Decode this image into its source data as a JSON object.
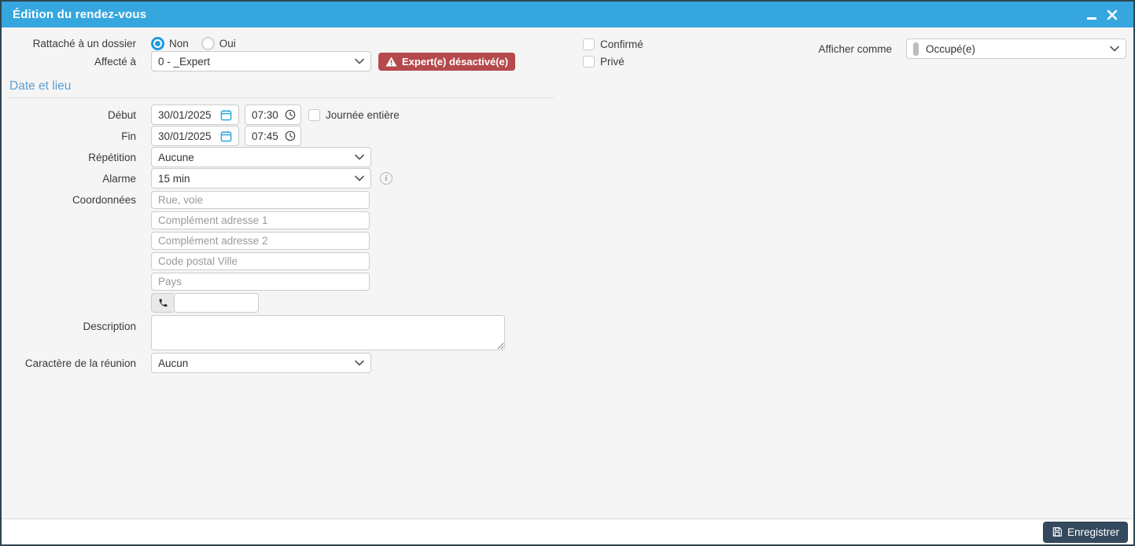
{
  "window": {
    "title": "Édition du rendez-vous"
  },
  "colors": {
    "titlebar": "#36a6df",
    "accent": "#1e9be2",
    "warning_badge": "#b5494c",
    "section_header": "#5b9fd4",
    "save_button": "#34495e"
  },
  "form": {
    "dossier": {
      "label": "Rattaché à un dossier",
      "options": [
        {
          "label": "Non",
          "selected": true
        },
        {
          "label": "Oui",
          "selected": false
        }
      ]
    },
    "affecte": {
      "label": "Affecté à",
      "value": "0 - _Expert",
      "warning": "Expert(e) désactivé(e)"
    },
    "flags": {
      "confirmed_label": "Confirmé",
      "confirmed_checked": false,
      "private_label": "Privé",
      "private_checked": false
    },
    "afficher_comme": {
      "label": "Afficher comme",
      "value": "Occupé(e)"
    },
    "section_date_lieu": "Date et lieu",
    "debut": {
      "label": "Début",
      "date": "30/01/2025",
      "time": "07:30",
      "allday_label": "Journée entière",
      "allday_checked": false
    },
    "fin": {
      "label": "Fin",
      "date": "30/01/2025",
      "time": "07:45"
    },
    "repetition": {
      "label": "Répétition",
      "value": "Aucune"
    },
    "alarme": {
      "label": "Alarme",
      "value": "15 min"
    },
    "coordonnees": {
      "label": "Coordonnées",
      "placeholders": [
        "Rue, voie",
        "Complément adresse 1",
        "Complément adresse 2",
        "Code postal Ville",
        "Pays"
      ],
      "phone_value": ""
    },
    "description": {
      "label": "Description",
      "value": ""
    },
    "caractere": {
      "label": "Caractère de la réunion",
      "value": "Aucun"
    }
  },
  "footer": {
    "save_label": "Enregistrer"
  }
}
